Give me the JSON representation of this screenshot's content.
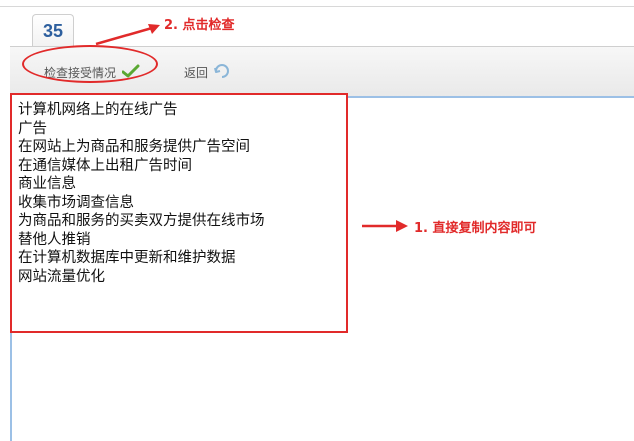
{
  "tab": {
    "label": "35"
  },
  "toolbar": {
    "check_label": "检查接受情况",
    "back_label": "返回"
  },
  "annotations": {
    "step2": "2. 点击检查",
    "step1": "1. 直接复制内容即可",
    "color": "#e12a2a"
  },
  "editor": {
    "lines": [
      "计算机网络上的在线广告",
      "广告",
      "在网站上为商品和服务提供广告空间",
      "在通信媒体上出租广告时间",
      "商业信息",
      "收集市场调查信息",
      "为商品和服务的买卖双方提供在线市场",
      "替他人推销",
      "在计算机数据库中更新和维护数据",
      "网站流量优化"
    ]
  },
  "icons": {
    "check": "check-icon",
    "back": "back-icon"
  }
}
